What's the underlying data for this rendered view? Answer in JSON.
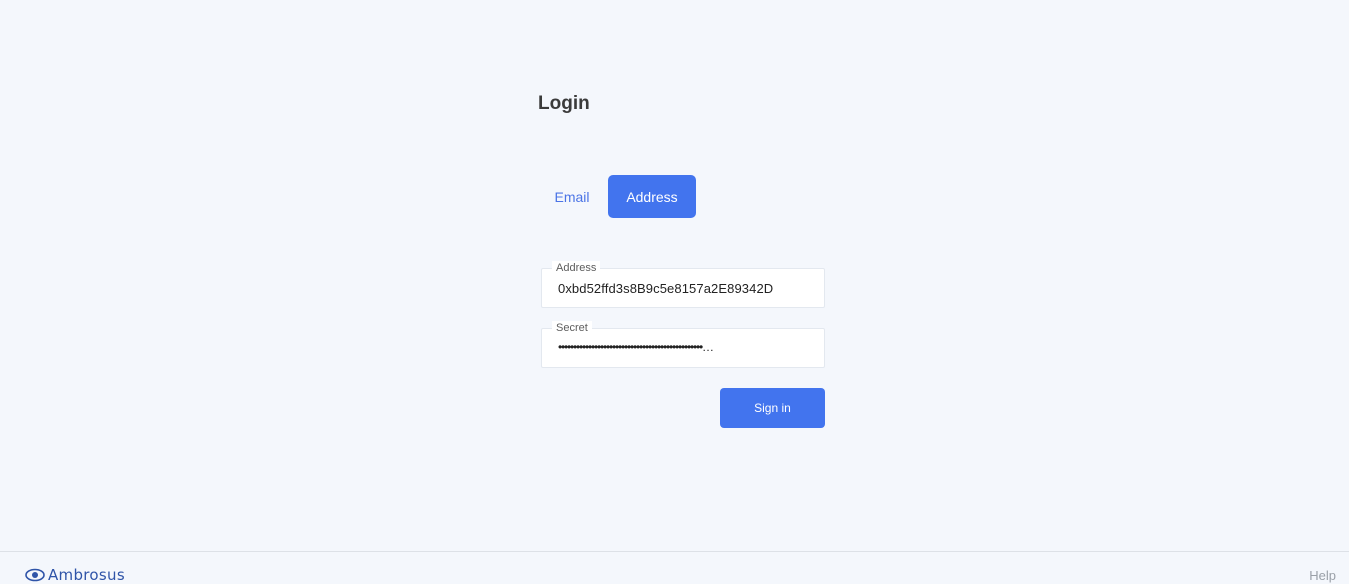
{
  "page": {
    "title": "Login"
  },
  "tabs": {
    "email_label": "Email",
    "address_label": "Address"
  },
  "form": {
    "address": {
      "label": "Address",
      "value": "0xbd52ffd3s8B9c5e8157a2E89342D"
    },
    "secret": {
      "label": "Secret",
      "value": "••••••••••••••••••••••••••••••••••••••••••••••••…"
    },
    "signin_label": "Sign in"
  },
  "footer": {
    "brand": "Ambrosus",
    "help_label": "Help"
  },
  "colors": {
    "accent": "#4274ee",
    "background": "#f4f7fc",
    "brand": "#2f54a8"
  }
}
